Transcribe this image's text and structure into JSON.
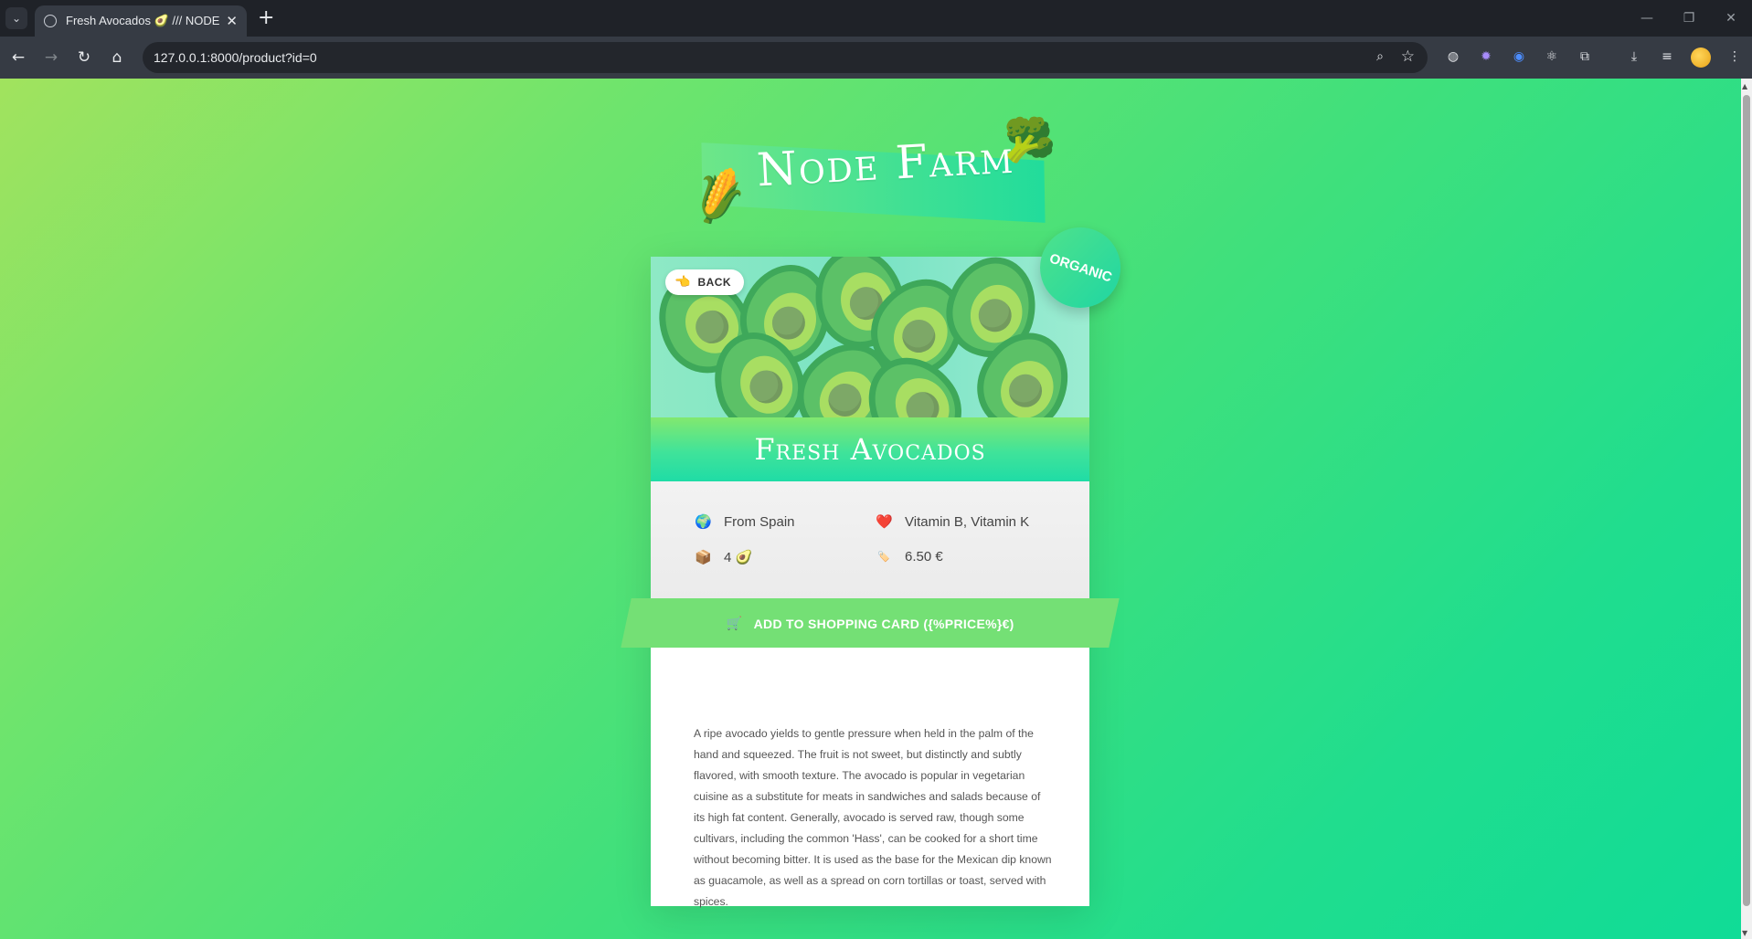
{
  "browser": {
    "tab_title": "Fresh Avocados 🥑 /// NODE F",
    "url": "127.0.0.1:8000/product?id=0",
    "icons": [
      "back-icon",
      "forward-icon",
      "reload-icon",
      "home-icon",
      "zoom-icon",
      "star-icon",
      "translate-icon",
      "extension-icon",
      "download-icon",
      "menu-icon"
    ]
  },
  "logo": {
    "text": "Node Farm",
    "left_emoji": "🌽",
    "right_emoji": "🥦"
  },
  "product": {
    "back_label": "BACK",
    "back_emoji": "👈",
    "organic_label": "ORGANIC",
    "name": "Fresh Avocados",
    "from_emoji": "🌍",
    "from": "From Spain",
    "nutrients_emoji": "❤️",
    "nutrients": "Vitamin B, Vitamin K",
    "quantity_emoji": "📦",
    "quantity": "4 🥑",
    "price_emoji": "🏷️",
    "price": "6.50 €",
    "cart_emoji": "🛒",
    "cta_label": "ADD TO SHOPPING CARD ({%PRICE%}€)",
    "description": "A ripe avocado yields to gentle pressure when held in the palm of the hand and squeezed. The fruit is not sweet, but distinctly and subtly flavored, with smooth texture. The avocado is popular in vegetarian cuisine as a substitute for meats in sandwiches and salads because of its high fat content. Generally, avocado is served raw, though some cultivars, including the common 'Hass', can be cooked for a short time without becoming bitter. It is used as the base for the Mexican dip known as guacamole, as well as a spread on corn tortillas or toast, served with spices."
  },
  "colors": {
    "accent_green": "#74e075",
    "badge_teal": "#1fd6a3"
  }
}
